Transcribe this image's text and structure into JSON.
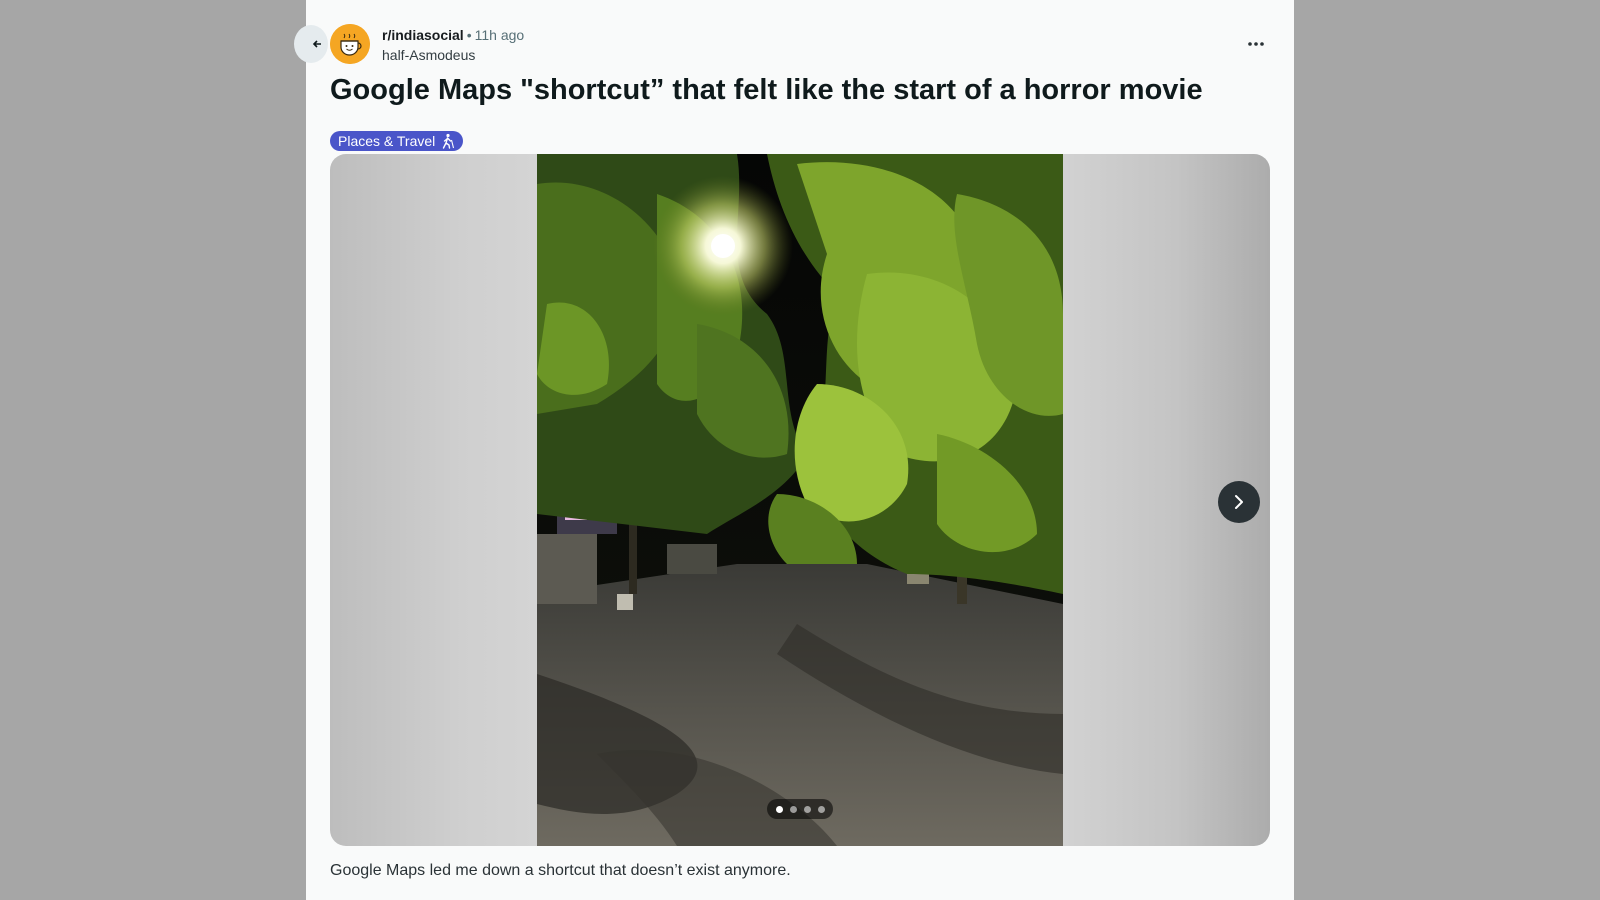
{
  "post": {
    "subreddit": "r/indiasocial",
    "time_ago": "11h ago",
    "separator": "•",
    "author": "half-Asmodeus",
    "title": "Google Maps \"shortcut” that felt like the start of a horror movie",
    "flair": {
      "label": "Places & Travel",
      "color": "#4a55c9",
      "icon": "walking-person-icon"
    },
    "gallery": {
      "image_count": 4,
      "current_index": 1,
      "next_icon": "chevron-right-icon"
    },
    "body": "Google Maps led me down a shortcut that doesn’t exist anymore.",
    "more_icon": "more-horizontal-icon",
    "back_icon": "arrow-left-icon"
  },
  "colors": {
    "page_background": "#a6a6a6",
    "card_background": "#f9fafa",
    "title_text": "#0f1a1c",
    "avatar_background": "#f5a623"
  }
}
